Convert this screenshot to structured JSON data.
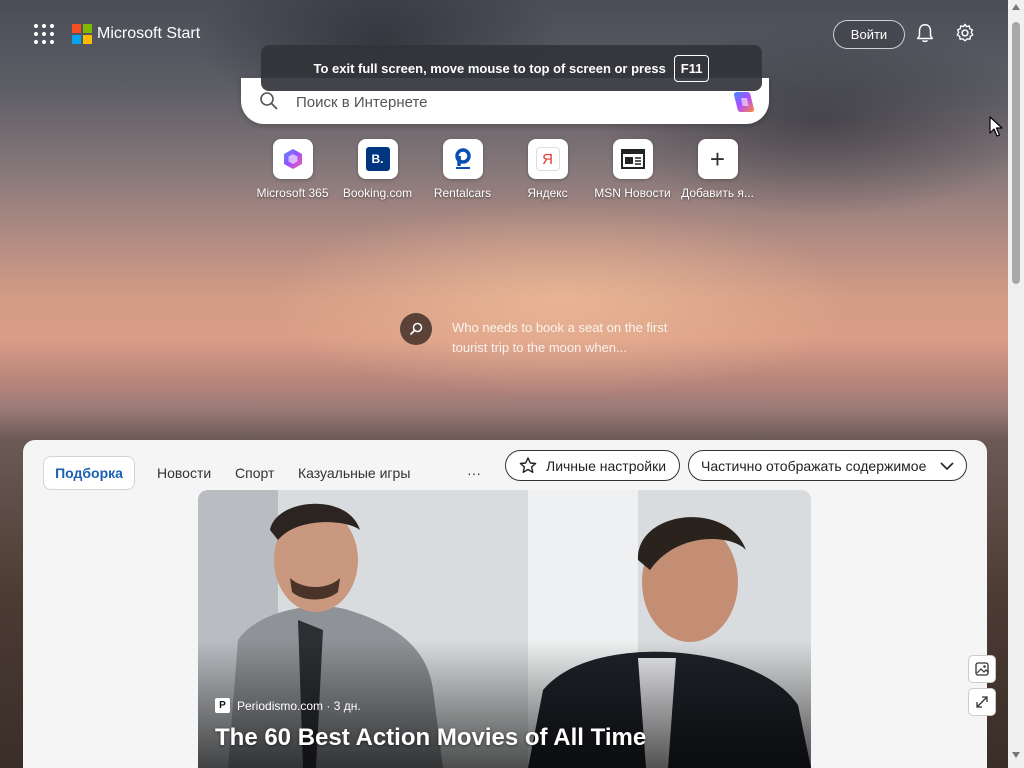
{
  "header": {
    "brand": "Microsoft Start",
    "signin_label": "Войти",
    "icons": [
      "apps-grid-icon",
      "microsoft-logo-icon",
      "bell-icon",
      "gear-icon"
    ]
  },
  "fullscreen_notice": {
    "text": "To exit full screen, move mouse to top of screen or press",
    "key": "F11"
  },
  "search": {
    "placeholder": "Поиск в Интернете"
  },
  "shortcuts": [
    {
      "label": "Microsoft 365",
      "icon": "microsoft-365-icon"
    },
    {
      "label": "Booking.com",
      "icon": "booking-icon",
      "glyph": "B."
    },
    {
      "label": "Rentalcars",
      "icon": "rentalcars-icon"
    },
    {
      "label": "Яндекс",
      "icon": "yandex-icon",
      "glyph": "Я"
    },
    {
      "label": "MSN Новости",
      "icon": "msn-news-icon"
    },
    {
      "label": "Добавить я...",
      "icon": "plus-icon",
      "glyph": "+"
    }
  ],
  "spotlight": {
    "text": "Who needs to book a seat on the first tourist trip to the moon when..."
  },
  "feed": {
    "tabs": [
      "Подборка",
      "Новости",
      "Спорт",
      "Казуальные игры"
    ],
    "more": "···",
    "personalize_label": "Личные настройки",
    "view_label": "Частично отображать содержимое"
  },
  "hero": {
    "source_glyph": "P",
    "source": "Periodismo.com · 3 дн.",
    "title": "The 60 Best Action Movies of All Time"
  },
  "colors": {
    "accent": "#1a5fb4",
    "ms_red": "#f25022",
    "ms_green": "#7fba00",
    "ms_blue": "#00a4ef",
    "ms_yellow": "#ffb900",
    "booking_blue": "#003580",
    "rentalcars_blue": "#0a4eb2",
    "yandex_red": "#e63b2e"
  }
}
